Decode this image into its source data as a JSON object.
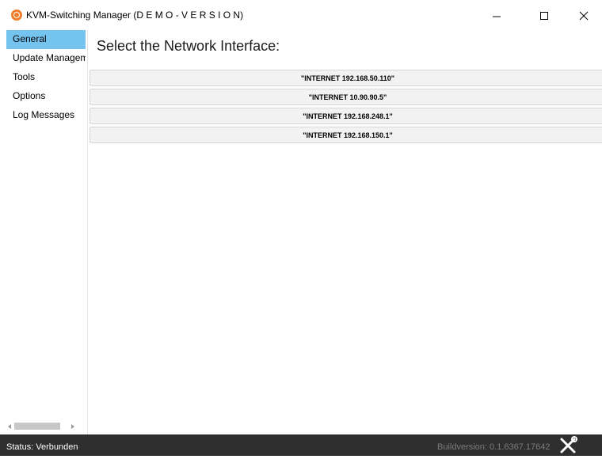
{
  "window": {
    "title": "KVM-Switching Manager (D E M O - V E R S I O N)",
    "app_icon": "kvm-app-icon",
    "controls": [
      "minimize-icon",
      "maximize-icon",
      "close-icon"
    ]
  },
  "sidebar": {
    "items": [
      {
        "label": "General",
        "selected": true
      },
      {
        "label": "Update Management",
        "selected": false
      },
      {
        "label": "Tools",
        "selected": false
      },
      {
        "label": "Options",
        "selected": false
      },
      {
        "label": "Log Messages",
        "selected": false
      }
    ]
  },
  "main": {
    "heading": "Select the Network Interface:",
    "interfaces": [
      {
        "label": "\"INTERNET 192.168.50.110\""
      },
      {
        "label": "\"INTERNET 10.90.90.5\""
      },
      {
        "label": "\"INTERNET 192.168.248.1\""
      },
      {
        "label": "\"INTERNET 192.168.150.1\""
      }
    ]
  },
  "status_bar": {
    "status": "Status: Verbunden",
    "build": "Buildversion: 0.1.6367.17642",
    "tool_icon": "tools-icon"
  },
  "colors": {
    "accent_selected": "#75c4ef",
    "app_icon": "#f07d2a",
    "status_bar_bg": "#2f2f2f"
  }
}
